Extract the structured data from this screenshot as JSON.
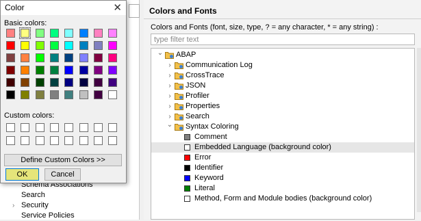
{
  "dialog": {
    "title": "Color",
    "close_glyph": "✕",
    "basic_label": "Basic colors:",
    "custom_label": "Custom colors:",
    "define_button": "Define Custom Colors >>",
    "ok_button": "OK",
    "cancel_button": "Cancel",
    "selected_basic_index": 1,
    "basic_colors": [
      "#ff8080",
      "#ffff80",
      "#80ff80",
      "#00ff80",
      "#80ffff",
      "#0080ff",
      "#ff80c0",
      "#ff80ff",
      "#ff0000",
      "#ffff00",
      "#80ff00",
      "#00ff40",
      "#00ffff",
      "#0080c0",
      "#8080c0",
      "#ff00ff",
      "#804040",
      "#ff8040",
      "#00ff00",
      "#008080",
      "#004080",
      "#8080ff",
      "#800040",
      "#ff0080",
      "#800000",
      "#ff8000",
      "#008000",
      "#008040",
      "#0000ff",
      "#0000a0",
      "#800080",
      "#8000ff",
      "#400000",
      "#804000",
      "#004000",
      "#004040",
      "#000080",
      "#000040",
      "#400040",
      "#400080",
      "#000000",
      "#808000",
      "#808040",
      "#808080",
      "#408080",
      "#c0c0c0",
      "#400040",
      "#ffffff"
    ],
    "custom_colors": [
      "#ffffff",
      "#ffffff",
      "#ffffff",
      "#ffffff",
      "#ffffff",
      "#ffffff",
      "#ffffff",
      "#ffffff",
      "#ffffff",
      "#ffffff",
      "#ffffff",
      "#ffffff",
      "#ffffff",
      "#ffffff",
      "#ffffff",
      "#ffffff"
    ]
  },
  "left_tree": [
    {
      "label": "Schema Associations",
      "expandable": false
    },
    {
      "label": "Search",
      "expandable": false
    },
    {
      "label": "Security",
      "expandable": true
    },
    {
      "label": "Service Policies",
      "expandable": false
    }
  ],
  "prefs": {
    "title": "Colors and Fonts",
    "description": "Colors and Fonts (font, size, type, ? = any character, * = any string) :",
    "filter_placeholder": "type filter text",
    "tree": [
      {
        "label": "ABAP",
        "level": 0,
        "kind": "folder",
        "expanded": true
      },
      {
        "label": "Communication Log",
        "level": 1,
        "kind": "folder",
        "expanded": false
      },
      {
        "label": "CrossTrace",
        "level": 1,
        "kind": "folder",
        "expanded": false
      },
      {
        "label": "JSON",
        "level": 1,
        "kind": "folder",
        "expanded": false
      },
      {
        "label": "Profiler",
        "level": 1,
        "kind": "folder",
        "expanded": false
      },
      {
        "label": "Properties",
        "level": 1,
        "kind": "folder",
        "expanded": false
      },
      {
        "label": "Search",
        "level": 1,
        "kind": "folder",
        "expanded": false
      },
      {
        "label": "Syntax Coloring",
        "level": 1,
        "kind": "folder",
        "expanded": true
      },
      {
        "label": "Comment",
        "level": 2,
        "kind": "color",
        "color": "#808080",
        "selected": false
      },
      {
        "label": "Embedded Language (background color)",
        "level": 2,
        "kind": "color",
        "color": "#ffffff",
        "selected": true
      },
      {
        "label": "Error",
        "level": 2,
        "kind": "color",
        "color": "#ff0000",
        "selected": false
      },
      {
        "label": "Identifier",
        "level": 2,
        "kind": "color",
        "color": "#000000",
        "selected": false
      },
      {
        "label": "Keyword",
        "level": 2,
        "kind": "color",
        "color": "#0000ff",
        "selected": false
      },
      {
        "label": "Literal",
        "level": 2,
        "kind": "color",
        "color": "#008000",
        "selected": false
      },
      {
        "label": "Method, Form and Module bodies (background color)",
        "level": 2,
        "kind": "color",
        "color": "#ffffff",
        "selected": false
      }
    ]
  }
}
